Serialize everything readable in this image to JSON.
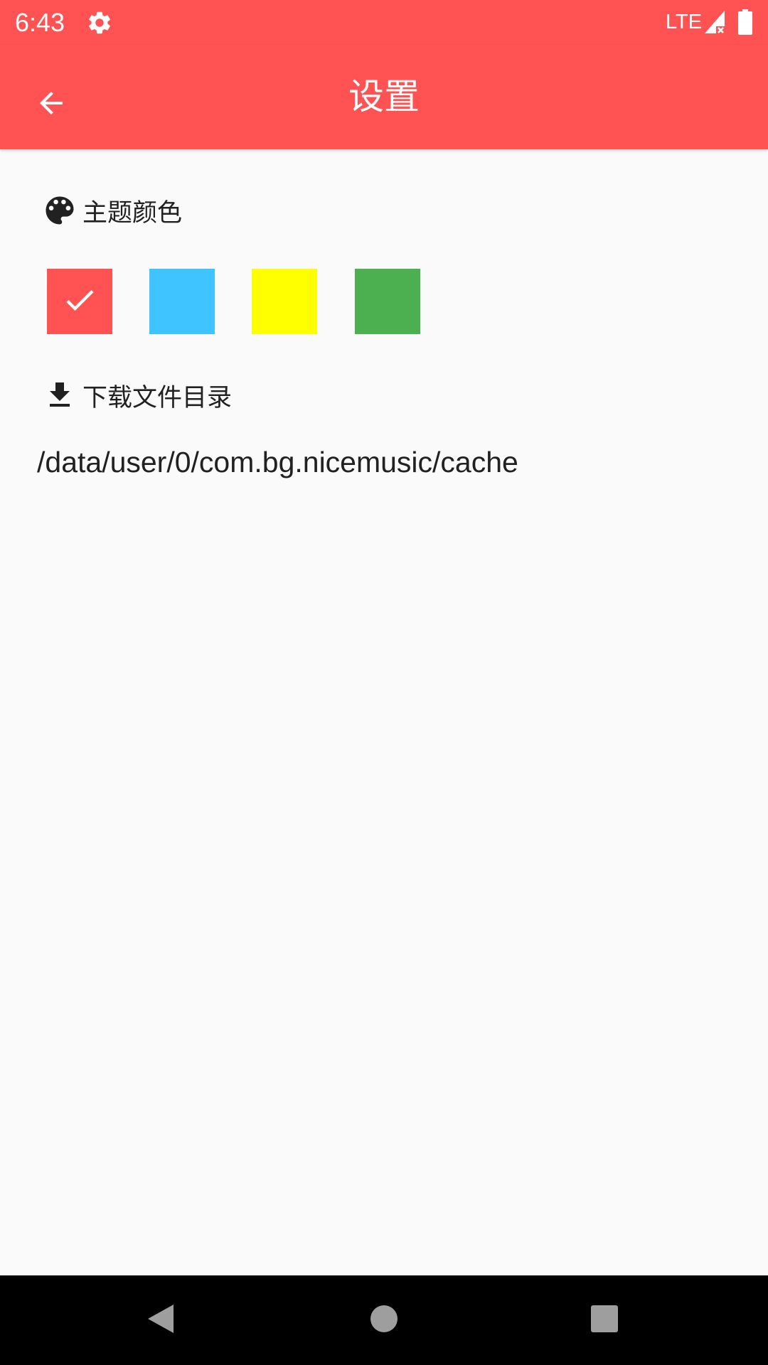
{
  "status_bar": {
    "time": "6:43",
    "network": "LTE",
    "icons": [
      "settings-icon",
      "signal-icon",
      "battery-icon"
    ]
  },
  "app_bar": {
    "title": "设置",
    "back_icon": "arrow-back-icon",
    "background_color": "#ff5252"
  },
  "theme_section": {
    "label": "主题颜色",
    "icon": "palette-icon",
    "swatches": [
      {
        "color": "#ff5252",
        "selected": true
      },
      {
        "color": "#40c4ff",
        "selected": false
      },
      {
        "color": "#ffff00",
        "selected": false
      },
      {
        "color": "#4caf50",
        "selected": false
      }
    ]
  },
  "download_section": {
    "label": "下载文件目录",
    "icon": "download-icon",
    "path": "/data/user/0/com.bg.nicemusic/cache"
  },
  "nav_bar": {
    "buttons": [
      "back-triangle-icon",
      "home-circle-icon",
      "recents-square-icon"
    ]
  }
}
